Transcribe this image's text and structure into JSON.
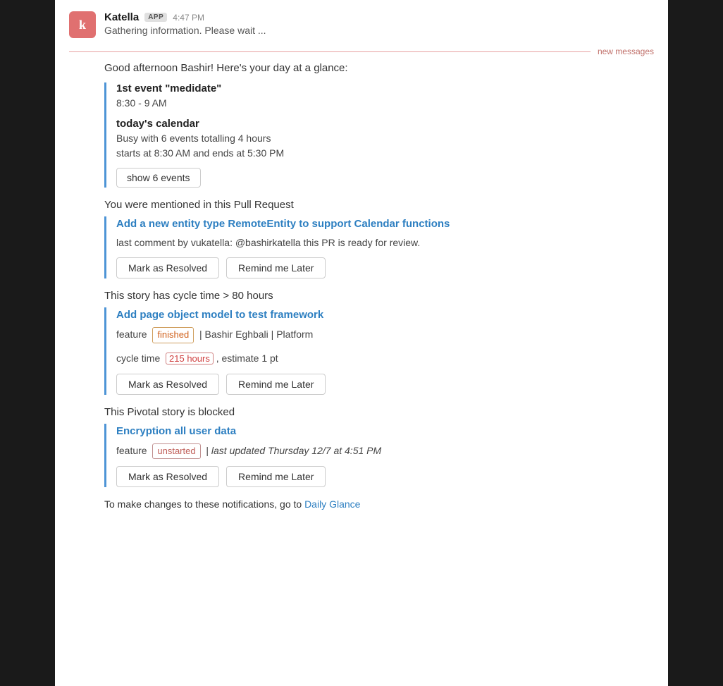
{
  "header": {
    "sender": "Katella",
    "badge": "APP",
    "time": "4:47 PM",
    "subtitle": "Gathering information.  Please wait ...",
    "avatar_letter": "k"
  },
  "new_messages_label": "new messages",
  "intro": "Good afternoon Bashir!  Here's your day at a glance:",
  "calendar_section": {
    "first_event_label": "1st event \"medidate\"",
    "first_event_time": "8:30 - 9 AM",
    "calendar_heading": "today's calendar",
    "calendar_busy": "Busy with 6 events totalling 4 hours",
    "calendar_times": "starts at 8:30 AM and ends at 5:30 PM",
    "show_events_btn": "show 6 events"
  },
  "pr_section": {
    "intro": "You were mentioned in this Pull Request",
    "title": "Add a new entity type RemoteEntity to support Calendar functions",
    "comment": "last comment by vukatella: @bashirkatella this PR is ready for review.",
    "btn_resolve": "Mark as Resolved",
    "btn_remind": "Remind me Later"
  },
  "story_section": {
    "intro": "This story has cycle time > 80 hours",
    "title": "Add page object model to test framework",
    "feature_label": "feature",
    "badge_finished": "finished",
    "author": "Bashir Eghbali",
    "platform": "Platform",
    "cycle_time_label": "cycle time",
    "cycle_time_value": "215 hours",
    "estimate": ", estimate 1 pt",
    "btn_resolve": "Mark as Resolved",
    "btn_remind": "Remind me Later"
  },
  "pivotal_section": {
    "intro": "This Pivotal story is blocked",
    "title": "Encryption all user data",
    "feature_label": "feature",
    "badge_unstarted": "unstarted",
    "last_updated": "last updated Thursday 12/7 at 4:51 PM",
    "btn_resolve": "Mark as Resolved",
    "btn_remind": "Remind me Later"
  },
  "footer": {
    "text": "To make changes to these notifications, go to",
    "link_text": "Daily Glance",
    "link_href": "#"
  }
}
